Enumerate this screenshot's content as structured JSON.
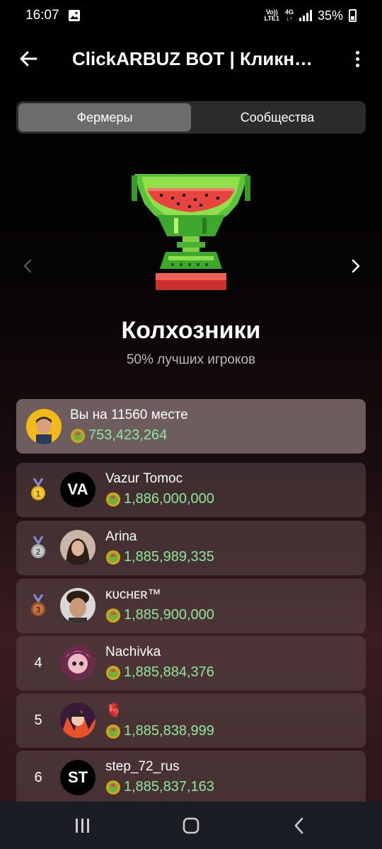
{
  "status": {
    "time": "16:07",
    "network_top": "Vo))",
    "network_bottom": "LTE1",
    "gen": "4G",
    "battery": "35%"
  },
  "header": {
    "title": "ClickARBUZ BOT | Кликн…"
  },
  "tabs": [
    {
      "label": "Фермеры",
      "active": true
    },
    {
      "label": "Сообщества",
      "active": false
    }
  ],
  "league": {
    "name": "Колхозники",
    "subtitle": "50% лучших игроков"
  },
  "me": {
    "label": "Вы на 11560 месте",
    "score": "753,423,264"
  },
  "leaderboard": [
    {
      "rank": "1",
      "name": "Vazur Tomoc",
      "initials": "VA",
      "score": "1,886,000,000"
    },
    {
      "rank": "2",
      "name": "Arina",
      "initials": "",
      "score": "1,885,989,335"
    },
    {
      "rank": "3",
      "name": "ᴋᴜᴄʜᴇʀ™",
      "initials": "",
      "score": "1,885,900,000"
    },
    {
      "rank": "4",
      "name": "Nachivka",
      "initials": "",
      "score": "1,885,884,376"
    },
    {
      "rank": "5",
      "name": "🫀",
      "initials": "",
      "score": "1,885,838,999"
    },
    {
      "rank": "6",
      "name": "step_72_rus",
      "initials": "ST",
      "score": "1,885,837,163"
    }
  ],
  "colors": {
    "score": "#8ee89a",
    "card": "#6d5d5f",
    "active_tab": "#6c6c6c"
  }
}
